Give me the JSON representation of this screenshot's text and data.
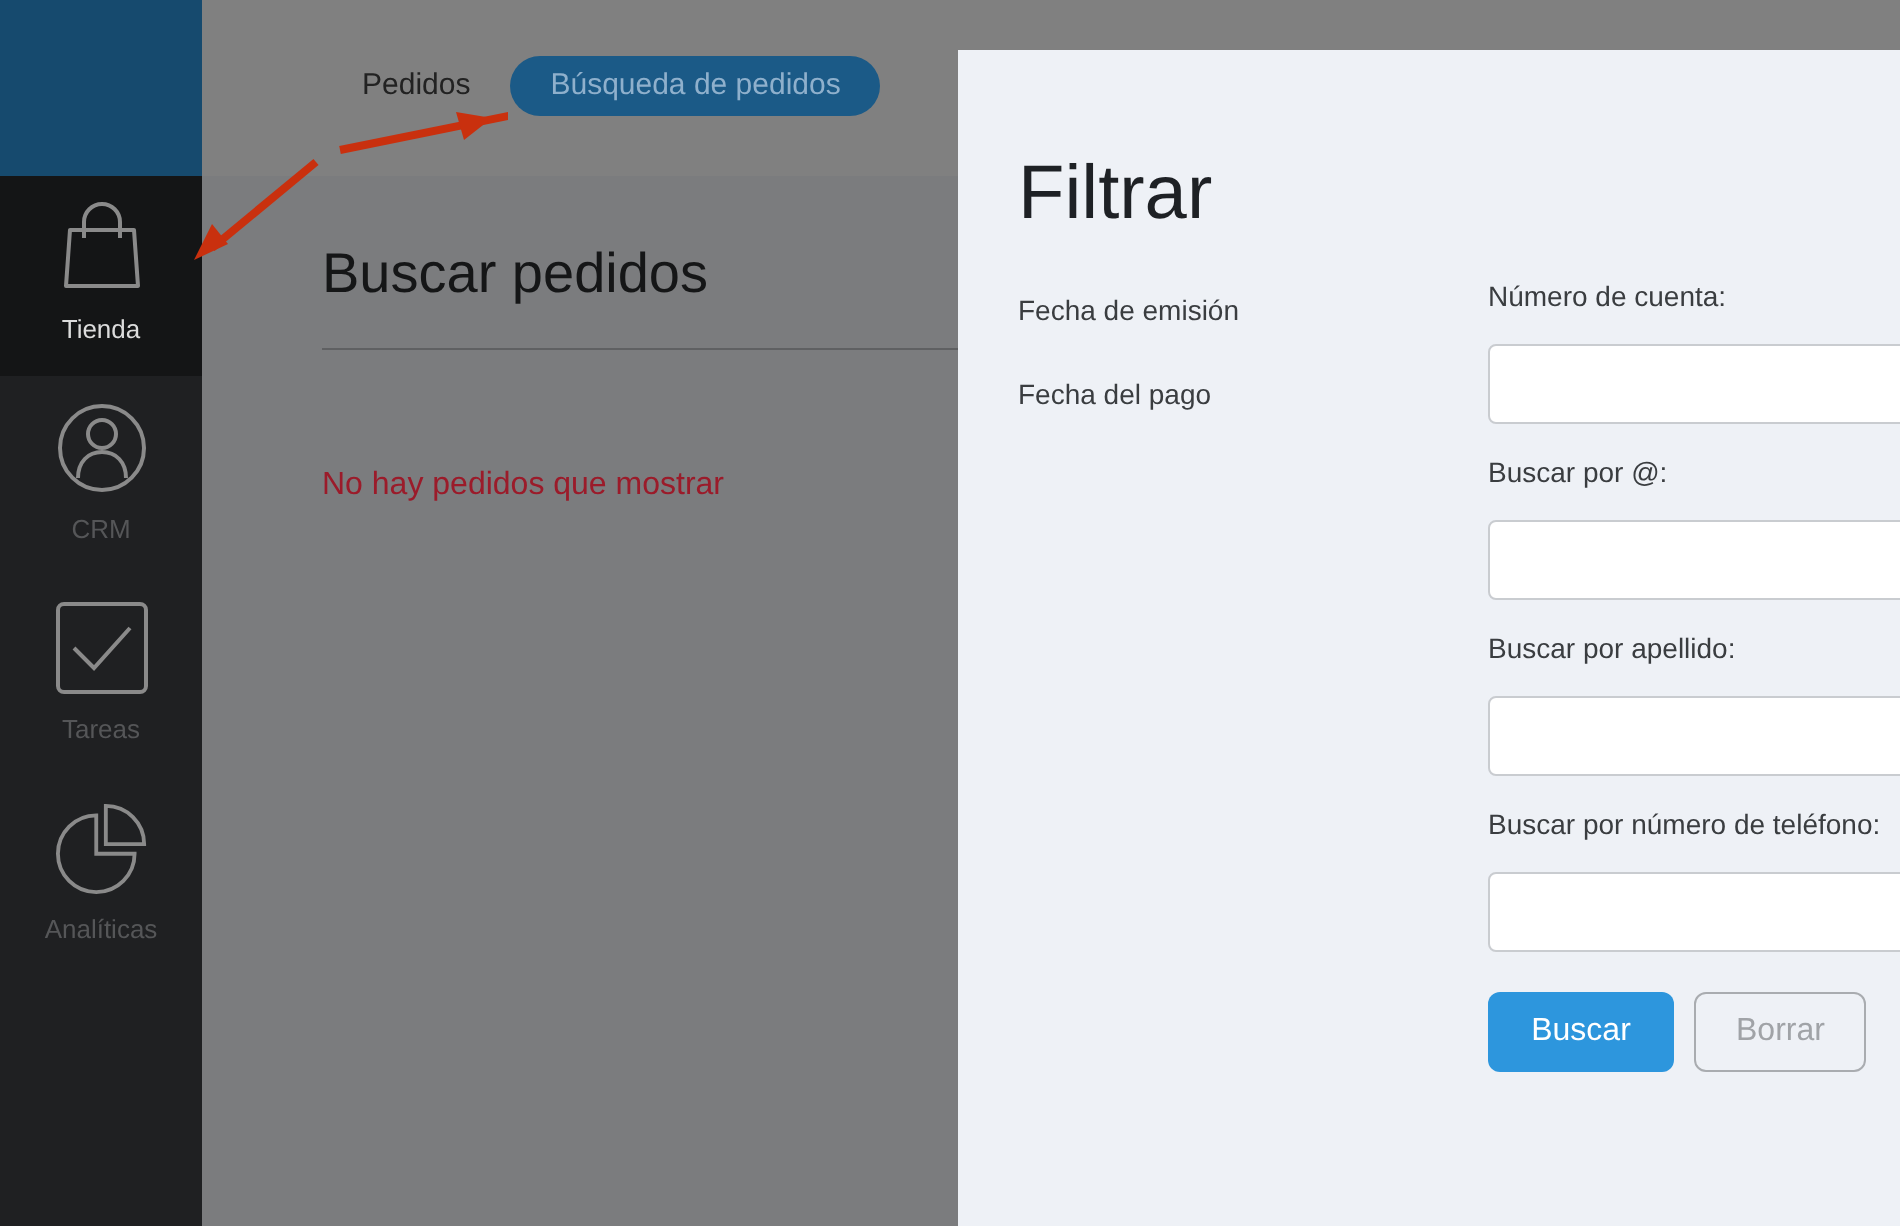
{
  "sidebar": {
    "items": [
      {
        "kind": "bag",
        "label": "Tienda",
        "selected": true
      },
      {
        "kind": "user",
        "label": "CRM",
        "selected": false
      },
      {
        "kind": "check",
        "label": "Tareas",
        "selected": false
      },
      {
        "kind": "pie",
        "label": "Analíticas",
        "selected": false
      }
    ]
  },
  "tabs": [
    {
      "label": "Pedidos",
      "selected": false
    },
    {
      "label": "Búsqueda de pedidos",
      "selected": true
    }
  ],
  "page": {
    "title": "Buscar pedidos",
    "empty_message": "No hay pedidos que mostrar"
  },
  "filter_panel": {
    "title": "Filtrar",
    "date_filters": [
      "Fecha de emisión",
      "Fecha del pago"
    ],
    "fields": [
      {
        "label": "Número de cuenta:"
      },
      {
        "label": "Buscar por @:"
      },
      {
        "label": "Buscar por apellido:"
      },
      {
        "label": "Buscar por número de teléfono:"
      }
    ],
    "buttons": [
      {
        "kind": "primary",
        "label": "Buscar"
      },
      {
        "kind": "secondary",
        "label": "Borrar"
      }
    ]
  }
}
